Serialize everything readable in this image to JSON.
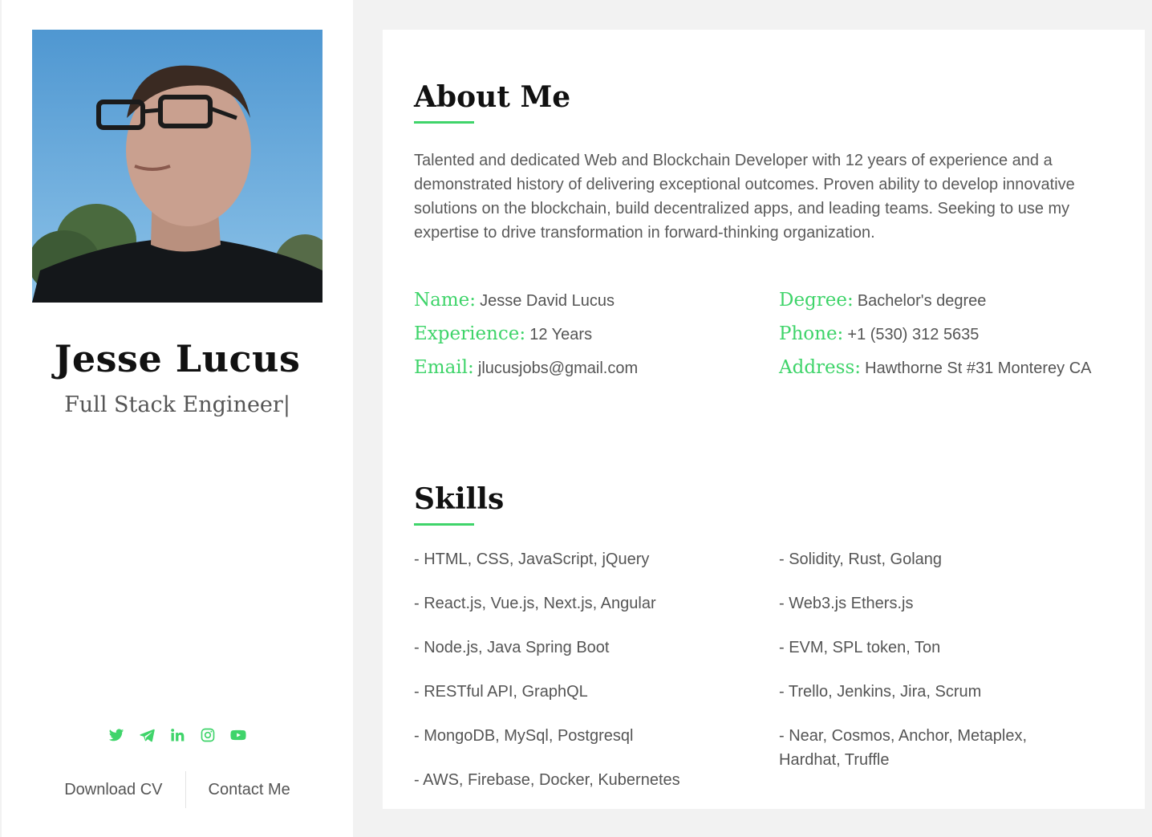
{
  "profile": {
    "name": "Jesse Lucus",
    "role": "Full Stack Engineer",
    "cursor": "|"
  },
  "socials": [
    {
      "icon": "twitter-icon"
    },
    {
      "icon": "telegram-icon"
    },
    {
      "icon": "linkedin-icon"
    },
    {
      "icon": "instagram-icon"
    },
    {
      "icon": "youtube-icon"
    }
  ],
  "actions": {
    "download_cv": "Download CV",
    "contact_me": "Contact Me"
  },
  "about": {
    "title": "About Me",
    "text": "Talented and dedicated Web and Blockchain Developer with 12 years of experience and a demonstrated history of delivering exceptional outcomes. Proven ability to develop innovative solutions on the blockchain, build decentralized apps, and leading teams. Seeking to use my expertise to drive transformation in forward-thinking organization.",
    "info": {
      "name": {
        "label": "Name:",
        "value": "Jesse David Lucus"
      },
      "degree": {
        "label": "Degree:",
        "value": "Bachelor's degree"
      },
      "experience": {
        "label": "Experience:",
        "value": "12 Years"
      },
      "phone": {
        "label": "Phone:",
        "value": "+1 (530) 312 5635"
      },
      "email": {
        "label": "Email:",
        "value": "jlucusjobs@gmail.com"
      },
      "address": {
        "label": "Address:",
        "value": "Hawthorne St #31 Monterey CA"
      }
    }
  },
  "skills": {
    "title": "Skills",
    "left": [
      "- HTML, CSS, JavaScript, jQuery",
      "- React.js, Vue.js, Next.js, Angular",
      "- Node.js, Java Spring Boot",
      "- RESTful API, GraphQL",
      "- MongoDB, MySql, Postgresql",
      "- AWS, Firebase, Docker, Kubernetes"
    ],
    "right": [
      "- Solidity, Rust, Golang",
      "- Web3.js Ethers.js",
      "- EVM, SPL token, Ton",
      "- Trello, Jenkins, Jira, Scrum",
      "- Near, Cosmos, Anchor, Metaplex, Hardhat, Truffle"
    ]
  },
  "colors": {
    "accent": "#3fd46a",
    "text": "#555555",
    "heading": "#111111",
    "background": "#f2f2f2"
  }
}
